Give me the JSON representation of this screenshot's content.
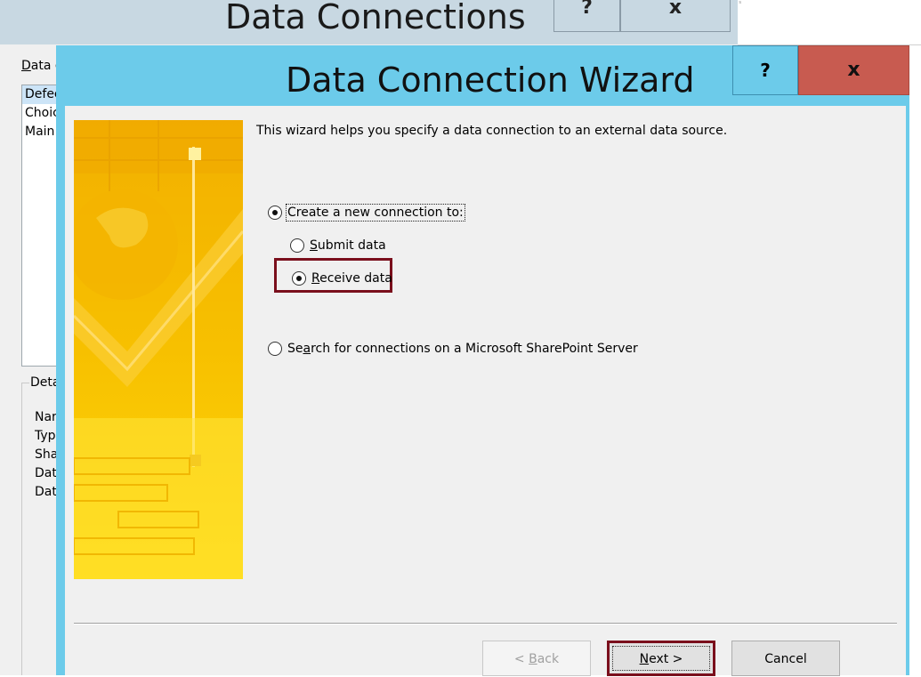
{
  "background_dialog": {
    "title": "Data Connections",
    "help_label": "?",
    "close_label": "x",
    "data_label": "Data c",
    "list_items": [
      "Defec",
      "Choic",
      "Main"
    ],
    "details_label": "Deta",
    "detail_fields": [
      "Nar",
      "Typ",
      "Sha",
      "Dat",
      "Dat"
    ],
    "strip_mark": "ˢ"
  },
  "wizard": {
    "title": "Data Connection Wizard",
    "help_label": "?",
    "close_label": "x",
    "intro": "This wizard helps you specify a data connection to an external data source.",
    "options": {
      "create": {
        "label": "Create a new connection to:",
        "selected": true
      },
      "submit": {
        "pre": "",
        "accel": "S",
        "post": "ubmit data",
        "selected": false
      },
      "receive": {
        "pre": "",
        "accel": "R",
        "post": "eceive data",
        "selected": true
      },
      "search": {
        "pre": "Se",
        "accel": "a",
        "post": "rch for connections on a Microsoft SharePoint Server",
        "selected": false
      }
    },
    "buttons": {
      "back": {
        "pre": "< ",
        "accel": "B",
        "post": "ack",
        "enabled": false
      },
      "next": {
        "pre": "",
        "accel": "N",
        "post": "ext >"
      },
      "cancel": "Cancel"
    }
  },
  "colors": {
    "wizard_frame": "#6ccbea",
    "close_button": "#c85b50",
    "highlight": "#7a0f1c",
    "banner": "#f7c200"
  }
}
